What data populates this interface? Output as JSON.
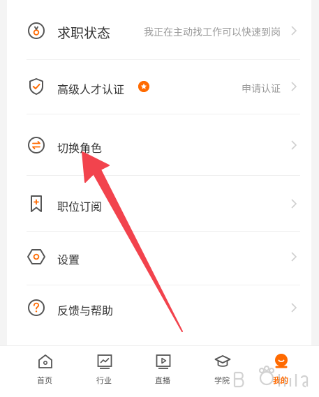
{
  "menu": {
    "items": [
      {
        "label": "求职状态",
        "value": "我正在主动找工作可以快速到岗",
        "icon": "medal-icon"
      },
      {
        "label": "高级人才认证",
        "value": "申请认证",
        "icon": "shield-check-icon",
        "badge": "star-badge-icon"
      },
      {
        "label": "切换角色",
        "value": "",
        "icon": "switch-icon"
      },
      {
        "label": "职位订阅",
        "value": "",
        "icon": "bookmark-icon"
      },
      {
        "label": "设置",
        "value": "",
        "icon": "settings-hexagon-icon"
      },
      {
        "label": "反馈与帮助",
        "value": "",
        "icon": "help-icon"
      }
    ]
  },
  "tabbar": {
    "tabs": [
      {
        "label": "首页",
        "icon": "home-icon",
        "active": false
      },
      {
        "label": "行业",
        "icon": "chart-icon",
        "active": false
      },
      {
        "label": "直播",
        "icon": "play-icon",
        "active": false
      },
      {
        "label": "学院",
        "icon": "graduation-cap-icon",
        "active": false
      },
      {
        "label": "我的",
        "icon": "profile-icon",
        "active": true
      }
    ]
  },
  "colors": {
    "accent": "#ff6a00",
    "annotation_arrow": "#f2434d",
    "text_primary": "#333333",
    "text_secondary": "#9a9a9a"
  }
}
